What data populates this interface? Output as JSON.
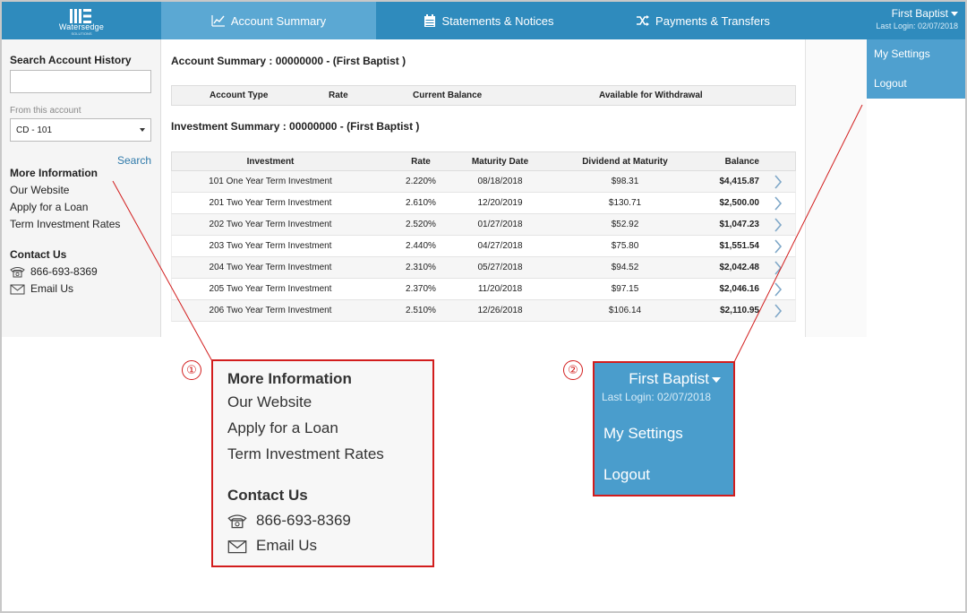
{
  "brand": {
    "name": "Watersedge",
    "tagline": "SOLUTIONS"
  },
  "nav": {
    "tabs": [
      {
        "label": "Account Summary",
        "icon": "chart-icon"
      },
      {
        "label": "Statements & Notices",
        "icon": "calendar-icon"
      },
      {
        "label": "Payments & Transfers",
        "icon": "shuffle-icon"
      }
    ]
  },
  "user": {
    "name": "First Baptist",
    "last_login": "Last Login: 02/07/2018"
  },
  "user_menu": {
    "items": [
      "My Settings",
      "Logout"
    ]
  },
  "sidebar": {
    "search_title": "Search Account History",
    "search_value": "",
    "from_label": "From this account",
    "account_select": "CD - 101",
    "search_button": "Search",
    "more_info_title": "More Information",
    "links": [
      "Our Website",
      "Apply for a Loan",
      "Term Investment Rates"
    ],
    "contact_title": "Contact Us",
    "phone": "866-693-8369",
    "email": "Email Us"
  },
  "account_summary": {
    "title": "Account Summary : 00000000 - (First Baptist )",
    "columns": [
      "Account Type",
      "Rate",
      "Current Balance",
      "Available for Withdrawal"
    ]
  },
  "investment_summary": {
    "title": "Investment Summary : 00000000 - (First Baptist )",
    "columns": [
      "Investment",
      "Rate",
      "Maturity Date",
      "Dividend at Maturity",
      "Balance"
    ],
    "rows": [
      [
        "101 One Year Term Investment",
        "2.220%",
        "08/18/2018",
        "$98.31",
        "$4,415.87"
      ],
      [
        "201 Two Year Term Investment",
        "2.610%",
        "12/20/2019",
        "$130.71",
        "$2,500.00"
      ],
      [
        "202 Two Year Term Investment",
        "2.520%",
        "01/27/2018",
        "$52.92",
        "$1,047.23"
      ],
      [
        "203 Two Year Term Investment",
        "2.440%",
        "04/27/2018",
        "$75.80",
        "$1,551.54"
      ],
      [
        "204 Two Year Term Investment",
        "2.310%",
        "05/27/2018",
        "$94.52",
        "$2,042.48"
      ],
      [
        "205 Two Year Term Investment",
        "2.370%",
        "11/20/2018",
        "$97.15",
        "$2,046.16"
      ],
      [
        "206 Two Year Term Investment",
        "2.510%",
        "12/26/2018",
        "$106.14",
        "$2,110.95"
      ]
    ]
  },
  "callouts": {
    "one": {
      "number": "①",
      "title": "More Information",
      "links": [
        "Our Website",
        "Apply for a Loan",
        "Term Investment Rates"
      ],
      "contact_title": "Contact Us",
      "phone": "866-693-8369",
      "email": "Email Us"
    },
    "two": {
      "number": "②",
      "name": "First Baptist",
      "last_login": "Last Login: 02/07/2018",
      "items": [
        "My Settings",
        "Logout"
      ]
    }
  },
  "colors": {
    "nav": "#2f8bbd",
    "nav_active": "#5ba8d3",
    "menu": "#4fa0cf",
    "callout": "#d21d1d",
    "link": "#2f7aaa"
  }
}
